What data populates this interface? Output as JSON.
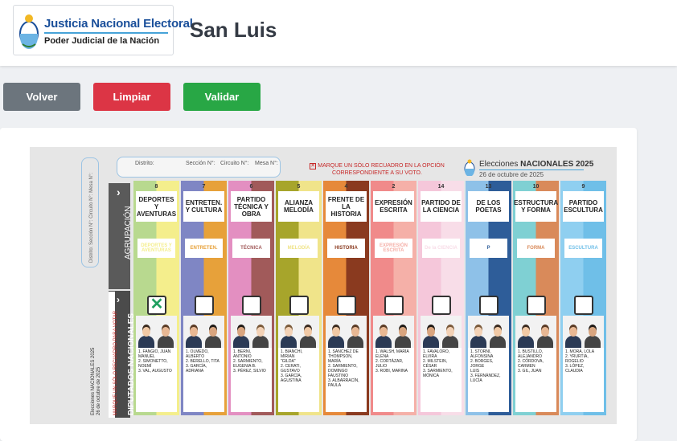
{
  "header": {
    "logo_title": "Justicia Nacional Electoral",
    "logo_subtitle": "Poder Judicial de la Nación",
    "page_title": "San Luis"
  },
  "buttons": {
    "back": "Volver",
    "clear": "Limpiar",
    "validate": "Validar"
  },
  "colors": {
    "back": "#6c757d",
    "clear": "#dc3545",
    "validate": "#28a745"
  },
  "ballot": {
    "district_label": "Distrito:",
    "section_label": "Sección N°:",
    "circuit_label": "Circuito N°:",
    "table_label": "Mesa N°:",
    "id_vertical": "Distrito:     Sección N°:  Circuito N°:  Mesa N°:",
    "instruction": "MARQUE UN SÓLO RECUADRO EN LA OPCIÓN CORRESPONDIENTE A SU VOTO.",
    "election_prefix": "Elecciones",
    "election_bold": "NACIONALES 2025",
    "election_date": "26 de octubre de 2025",
    "row_group_label": "AGRUPACIÓN",
    "row_deputies_label": "DIPUTADOS NACIONALES",
    "row_deputies_instruction": "MARQUE UN SÓLO RECUADRO PARA VOTAR",
    "left_election": "Elecciones NACIONALES 2025",
    "left_date": "26 de octubre de 2025",
    "parties": [
      {
        "number": "8",
        "name": "DEPORTES Y AVENTURAS",
        "logo": "DEPORTES Y AVENTURAS",
        "selected": true,
        "mark": "✕",
        "bg": "#b8d98f",
        "bg2": "#f4ee8c",
        "candidates": "1. FANGIO, JUAN\nMANUEL\n2. SIMONETTO,\nNOEMÍ\n3. VAL, AUGUSTO"
      },
      {
        "number": "7",
        "name": "ENTRETEN. Y CULTURA",
        "logo": "ENTRETEN.",
        "selected": false,
        "mark": "",
        "bg": "#7f86c4",
        "bg2": "#e7a13a",
        "candidates": "1. OLMEDO,\nALBERTO\n2. BERELLO, TITA\n3. GARCÍA, ADRIANA"
      },
      {
        "number": "6",
        "name": "PARTIDO TÉCNICA Y OBRA",
        "logo": "TÉCNICA",
        "selected": false,
        "mark": "",
        "bg": "#e38fc1",
        "bg2": "#a15a5a",
        "candidates": "1. BERNI, ANTONIO\n2. SARMIENTO,\nEUGENIA B.\n3. PÉREZ, SILVIO"
      },
      {
        "number": "5",
        "name": "ALIANZA MELODÍA",
        "logo": "MELODÍA",
        "selected": false,
        "mark": "",
        "bg": "#a7a52b",
        "bg2": "#f0e48a",
        "candidates": "1. BIANCHI, MIRIAN\n\"GILDA\"\n2. CERATI,\nGUSTAVO\n3. GARCÍA,\nAGUSTINA"
      },
      {
        "number": "4",
        "name": "FRENTE DE LA HISTORIA",
        "logo": "HISTORIA",
        "selected": false,
        "mark": "",
        "bg": "#e6893a",
        "bg2": "#8a3a1f",
        "candidates": "1. SÁNCHEZ DE\nTHOMPSON, MARÍA\n2. SARMIENTO,\nDOMINGO FAUSTINO\n3. ALBARRACÍN,\nPAULA"
      },
      {
        "number": "2",
        "name": "EXPRESIÓN ESCRITA",
        "logo": "EXPRESIÓN ESCRITA",
        "selected": false,
        "mark": "",
        "bg": "#f08a8a",
        "bg2": "#f5b0a8",
        "candidates": "1. WALSH, MARÍA\nELENA\n2. CORTÁZAR, JULIO\n3. ROBI, MARINA"
      },
      {
        "number": "14",
        "name": "PARTIDO DE LA CIENCIA",
        "logo": "De la CIENCIA",
        "selected": false,
        "mark": "",
        "bg": "#f5c7da",
        "bg2": "#f8dde8",
        "candidates": "1. FAVALORO, ELVIRA\n2. MILSTEIN, CÉSAR\n3. SARMIENTO,\nMÓNICA"
      },
      {
        "number": "13",
        "name": "DE LOS POETAS",
        "logo": "P",
        "selected": false,
        "mark": "",
        "bg": "#8ec1e8",
        "bg2": "#2e5d99",
        "candidates": "1. STORNI,\nALFONSINA\n2. BORGES, JORGE\nLUIS\n3. FERNÁNDEZ,\nLUCÍA"
      },
      {
        "number": "10",
        "name": "ESTRUCTURA Y FORMA",
        "logo": "FORMA",
        "selected": false,
        "mark": "",
        "bg": "#7fd0d3",
        "bg2": "#d98a5a",
        "candidates": "1. BUSTILLO,\nALEJANDRO\n2. CÓRDOVA,\nCARMEN\n3. GIL, JUAN"
      },
      {
        "number": "9",
        "name": "PARTIDO ESCULTURA",
        "logo": "ESCULTURA",
        "selected": false,
        "mark": "",
        "bg": "#8fcff0",
        "bg2": "#6fbfe8",
        "candidates": "1. MORA, LOLA\n2. YRURTIA,\nROGELIO\n3. LÓPEZ, CLAUDIA"
      }
    ]
  }
}
